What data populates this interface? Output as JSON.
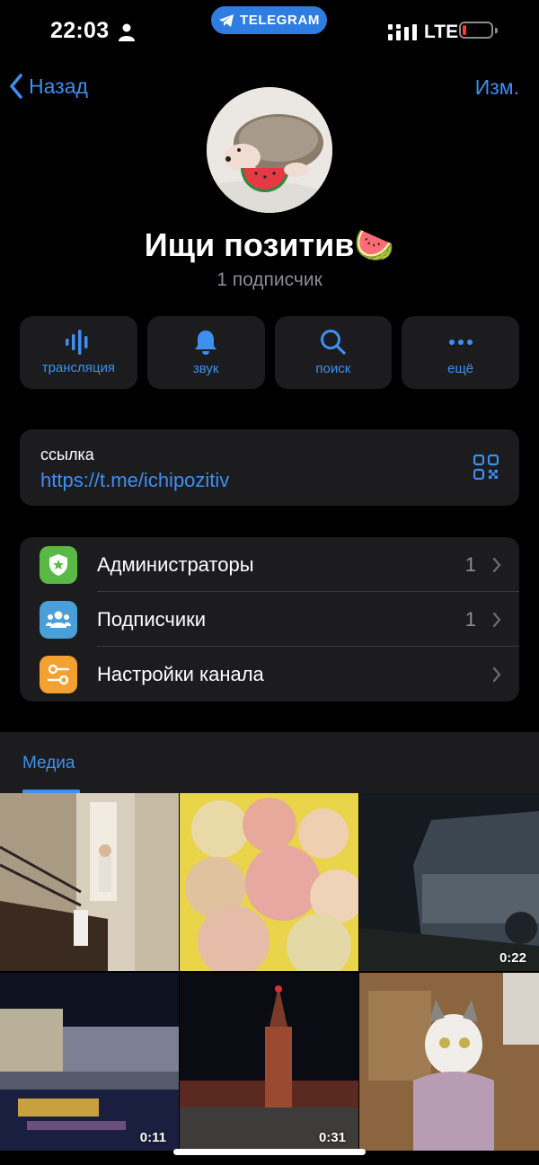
{
  "status": {
    "time": "22:03",
    "app_pill": "TELEGRAM",
    "network": "LTE"
  },
  "nav": {
    "back_label": "Назад",
    "edit_label": "Изм."
  },
  "channel": {
    "title": "Ищи позитив🍉",
    "subscribers_text": "1 подписчик"
  },
  "actions": [
    {
      "label": "трансляция",
      "icon": "broadcast-icon"
    },
    {
      "label": "звук",
      "icon": "bell-icon"
    },
    {
      "label": "поиск",
      "icon": "search-icon"
    },
    {
      "label": "ещё",
      "icon": "more-icon"
    }
  ],
  "link": {
    "title": "ссылка",
    "url": "https://t.me/ichipozitiv"
  },
  "menu": [
    {
      "label": "Администраторы",
      "count": "1",
      "icon": "admin-shield-icon",
      "color": "#5ab946"
    },
    {
      "label": "Подписчики",
      "count": "1",
      "icon": "people-icon",
      "color": "#4a9fd8"
    },
    {
      "label": "Настройки канала",
      "count": "",
      "icon": "settings-sliders-icon",
      "color": "#f3a130"
    }
  ],
  "media": {
    "tab_label": "Медиа",
    "items": [
      {
        "kind": "photo",
        "duration": ""
      },
      {
        "kind": "photo",
        "duration": ""
      },
      {
        "kind": "video",
        "duration": "0:22"
      },
      {
        "kind": "video",
        "duration": "0:11"
      },
      {
        "kind": "video",
        "duration": "0:31"
      },
      {
        "kind": "photo",
        "duration": ""
      }
    ]
  },
  "colors": {
    "accent": "#3e8ff0",
    "card": "#1c1c1e",
    "secondary_text": "#8d8d93"
  }
}
